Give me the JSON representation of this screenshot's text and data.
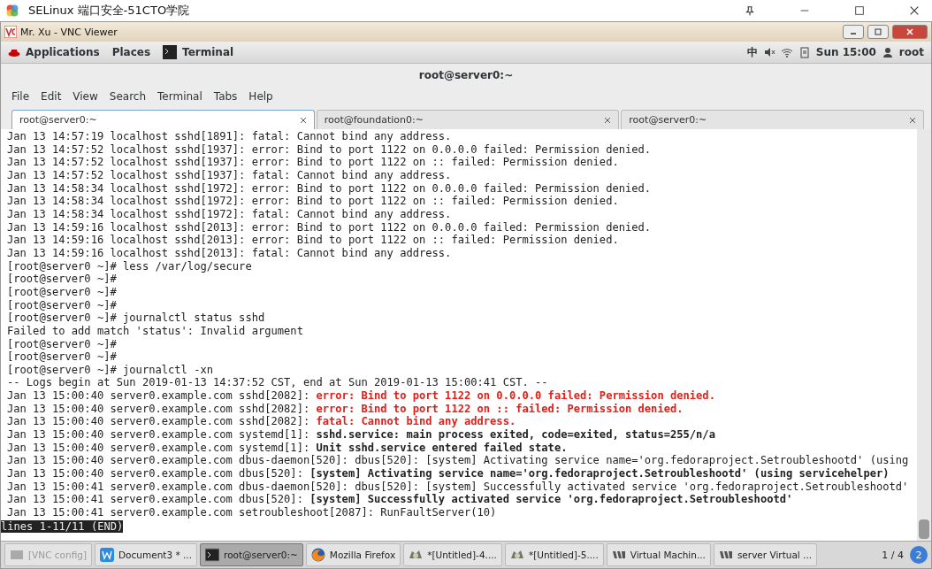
{
  "host_window": {
    "title": "SELinux 端口安全-51CTO学院"
  },
  "vnc_window": {
    "title": "Mr. Xu - VNC Viewer"
  },
  "top_bar": {
    "menus": [
      "Applications",
      "Places"
    ],
    "active_app": "Terminal",
    "input_method": "中",
    "clock": "Sun 15:00",
    "user": "root"
  },
  "terminal": {
    "title": "root@server0:~",
    "menu": [
      "File",
      "Edit",
      "View",
      "Search",
      "Terminal",
      "Tabs",
      "Help"
    ],
    "tabs": [
      {
        "label": "root@server0:~",
        "selected": true
      },
      {
        "label": "root@foundation0:~",
        "selected": false
      },
      {
        "label": "root@server0:~",
        "selected": false
      }
    ],
    "lines": [
      {
        "kind": "plain",
        "message": "Jan 13 14:57:19 localhost sshd[1891]: fatal: Cannot bind any address."
      },
      {
        "kind": "plain",
        "message": "Jan 13 14:57:52 localhost sshd[1937]: error: Bind to port 1122 on 0.0.0.0 failed: Permission denied."
      },
      {
        "kind": "plain",
        "message": "Jan 13 14:57:52 localhost sshd[1937]: error: Bind to port 1122 on :: failed: Permission denied."
      },
      {
        "kind": "plain",
        "message": "Jan 13 14:57:52 localhost sshd[1937]: fatal: Cannot bind any address."
      },
      {
        "kind": "plain",
        "message": "Jan 13 14:58:34 localhost sshd[1972]: error: Bind to port 1122 on 0.0.0.0 failed: Permission denied."
      },
      {
        "kind": "plain",
        "message": "Jan 13 14:58:34 localhost sshd[1972]: error: Bind to port 1122 on :: failed: Permission denied."
      },
      {
        "kind": "plain",
        "message": "Jan 13 14:58:34 localhost sshd[1972]: fatal: Cannot bind any address."
      },
      {
        "kind": "plain",
        "message": "Jan 13 14:59:16 localhost sshd[2013]: error: Bind to port 1122 on 0.0.0.0 failed: Permission denied."
      },
      {
        "kind": "plain",
        "message": "Jan 13 14:59:16 localhost sshd[2013]: error: Bind to port 1122 on :: failed: Permission denied."
      },
      {
        "kind": "plain",
        "message": "Jan 13 14:59:16 localhost sshd[2013]: fatal: Cannot bind any address."
      },
      {
        "kind": "plain",
        "message": "[root@server0 ~]# less /var/log/secure"
      },
      {
        "kind": "plain",
        "message": "[root@server0 ~]#"
      },
      {
        "kind": "plain",
        "message": "[root@server0 ~]#"
      },
      {
        "kind": "plain",
        "message": "[root@server0 ~]#"
      },
      {
        "kind": "plain",
        "message": "[root@server0 ~]# journalctl status sshd"
      },
      {
        "kind": "plain",
        "message": "Failed to add match 'status': Invalid argument"
      },
      {
        "kind": "plain",
        "message": "[root@server0 ~]#"
      },
      {
        "kind": "plain",
        "message": "[root@server0 ~]#"
      },
      {
        "kind": "plain",
        "message": "[root@server0 ~]# journalctl -xn"
      },
      {
        "kind": "plain",
        "message": "-- Logs begin at Sun 2019-01-13 14:37:52 CST, end at Sun 2019-01-13 15:00:41 CST. --"
      },
      {
        "kind": "error",
        "prefix": "Jan 13 15:00:40 server0.example.com sshd[2082]: ",
        "message": "error: Bind to port 1122 on 0.0.0.0 failed: Permission denied."
      },
      {
        "kind": "error",
        "prefix": "Jan 13 15:00:40 server0.example.com sshd[2082]: ",
        "message": "error: Bind to port 1122 on :: failed: Permission denied."
      },
      {
        "kind": "error",
        "prefix": "Jan 13 15:00:40 server0.example.com sshd[2082]: ",
        "message": "fatal: Cannot bind any address."
      },
      {
        "kind": "bold",
        "prefix": "Jan 13 15:00:40 server0.example.com systemd[1]: ",
        "message": "sshd.service: main process exited, code=exited, status=255/n/a"
      },
      {
        "kind": "bold",
        "prefix": "Jan 13 15:00:40 server0.example.com systemd[1]: ",
        "message": "Unit sshd.service entered failed state."
      },
      {
        "kind": "plain",
        "message": "Jan 13 15:00:40 server0.example.com dbus-daemon[520]: dbus[520]: [system] Activating service name='org.fedoraproject.Setroubleshootd' (using"
      },
      {
        "kind": "bold",
        "prefix": "Jan 13 15:00:40 server0.example.com dbus[520]: ",
        "message": "[system] Activating service name='org.fedoraproject.Setroubleshootd' (using servicehelper)"
      },
      {
        "kind": "plain",
        "message": "Jan 13 15:00:41 server0.example.com dbus-daemon[520]: dbus[520]: [system] Successfully activated service 'org.fedoraproject.Setroubleshootd'"
      },
      {
        "kind": "bold",
        "prefix": "Jan 13 15:00:41 server0.example.com dbus[520]: ",
        "message": "[system] Successfully activated service 'org.fedoraproject.Setroubleshootd'"
      },
      {
        "kind": "plain",
        "message": "Jan 13 15:00:41 server0.example.com setroubleshoot[2087]: RunFaultServer(10)"
      }
    ],
    "pager_status": "lines 1-11/11 (END)"
  },
  "taskbar": {
    "items": [
      {
        "label": "[VNC config]",
        "selected": false,
        "disabled": true,
        "kind": "config"
      },
      {
        "label": "Document3 * ...",
        "selected": false,
        "disabled": false,
        "kind": "writer"
      },
      {
        "label": "root@server0:~",
        "selected": true,
        "disabled": false,
        "kind": "terminal"
      },
      {
        "label": "Mozilla Firefox",
        "selected": false,
        "disabled": false,
        "kind": "browser"
      },
      {
        "label": "*[Untitled]-4....",
        "selected": false,
        "disabled": false,
        "kind": "image"
      },
      {
        "label": "*[Untitled]-5....",
        "selected": false,
        "disabled": false,
        "kind": "image"
      },
      {
        "label": "Virtual Machin...",
        "selected": false,
        "disabled": false,
        "kind": "vm"
      },
      {
        "label": "server Virtual ...",
        "selected": false,
        "disabled": false,
        "kind": "vm"
      }
    ],
    "pager": "1 / 4",
    "badge": "2"
  }
}
